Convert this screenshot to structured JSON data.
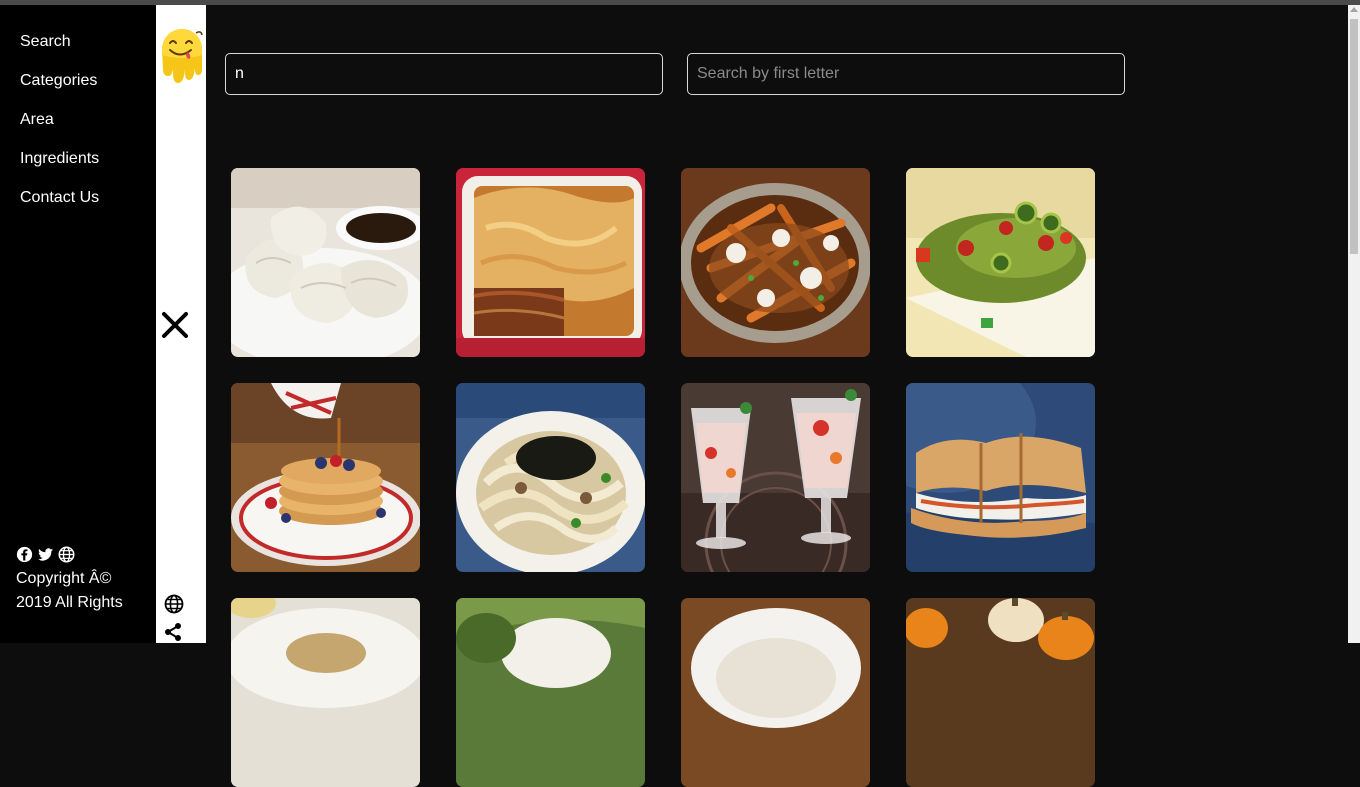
{
  "nav": {
    "items": [
      {
        "label": "Search"
      },
      {
        "label": "Categories"
      },
      {
        "label": "Area"
      },
      {
        "label": "Ingredients"
      },
      {
        "label": "Contact Us"
      }
    ]
  },
  "footer": {
    "social_icons": [
      "facebook-icon",
      "twitter-icon",
      "globe-icon"
    ],
    "copyright_line1": "Copyright Â©",
    "copyright_line2": "2019 All Rights"
  },
  "toggle_strip": {
    "icons": [
      "logo-emoji-icon",
      "close-icon",
      "globe-icon",
      "share-icon"
    ]
  },
  "search": {
    "name_value": "n",
    "name_placeholder": "",
    "letter_value": "",
    "letter_placeholder": "Search by first letter"
  },
  "meals": [
    {
      "image": "dumplings"
    },
    {
      "image": "lasagna"
    },
    {
      "image": "poutine"
    },
    {
      "image": "jalapeno salad"
    },
    {
      "image": "pancakes"
    },
    {
      "image": "udon noodles"
    },
    {
      "image": "trifle cups"
    },
    {
      "image": "sandwich"
    },
    {
      "image": "plated dish"
    },
    {
      "image": "rice dish"
    },
    {
      "image": "plate"
    },
    {
      "image": "pumpkins"
    }
  ],
  "colors": {
    "page_bg": "#0d0d0d",
    "sidebar_bg": "#000000",
    "strip_bg": "#ffffff",
    "input_border": "#d9d9d9",
    "logo_yellow": "#f5c518"
  }
}
